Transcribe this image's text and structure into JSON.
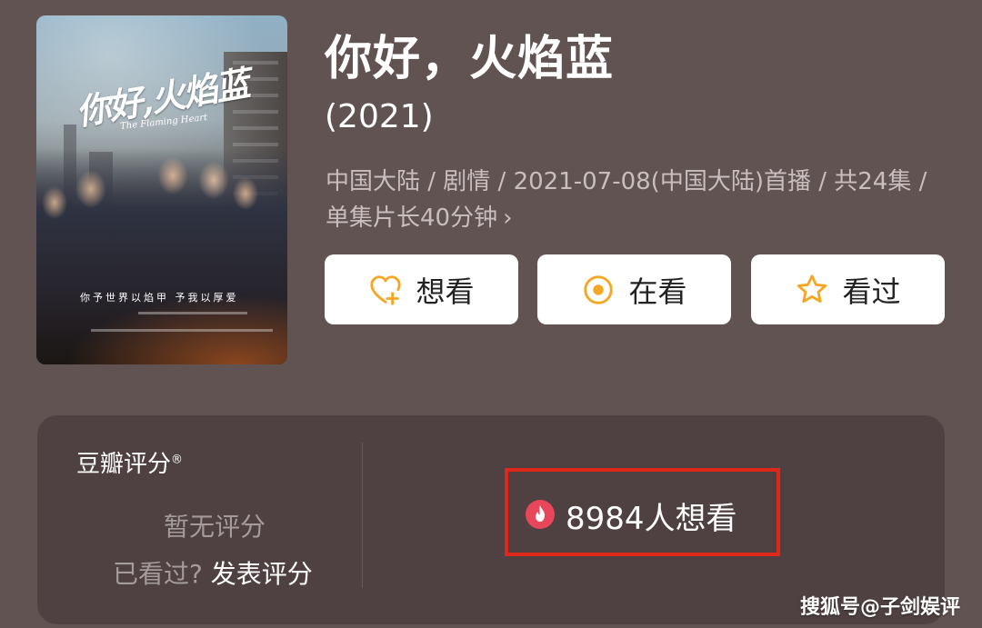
{
  "poster": {
    "title": "你好,火焰蓝",
    "subtitle": "The Flaming Heart",
    "slogan": "你予世界以焰甲 予我以厚爱"
  },
  "show": {
    "title": "你好，火焰蓝",
    "year": "(2021)",
    "meta": "中国大陆 / 剧情 / 2021-07-08(中国大陆)首播 / 共24集 / 单集片长40分钟",
    "meta_chevron": "›"
  },
  "actions": {
    "want": "想看",
    "watching": "在看",
    "watched": "看过"
  },
  "colors": {
    "accent": "#f5a623",
    "background": "#625353",
    "card": "#4f4141",
    "highlight_border": "#e0271c",
    "hot_icon": "#e8465a"
  },
  "rating": {
    "title": "豆瓣评分",
    "registered": "®",
    "no_score": "暂无评分",
    "seen_prefix": "已看过?",
    "post_link": "发表评分",
    "want_count": "8984人想看"
  },
  "watermark": "搜狐号@子剑娱评"
}
